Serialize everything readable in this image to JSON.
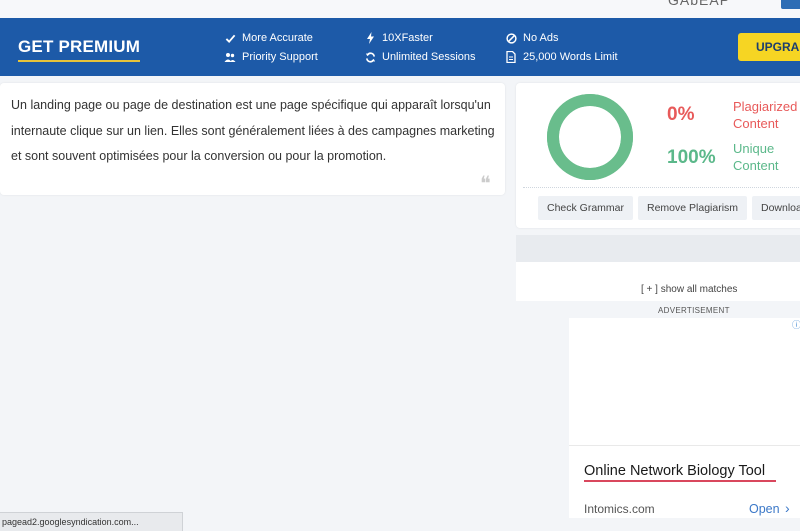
{
  "header_strip": {
    "cut_text": "GAbEAP"
  },
  "premium": {
    "title": "GET PREMIUM",
    "features": [
      {
        "icon": "check-icon",
        "label": "More Accurate"
      },
      {
        "icon": "users-icon",
        "label": "Priority Support"
      },
      {
        "icon": "bolt-icon",
        "label": "10XFaster"
      },
      {
        "icon": "refresh-icon",
        "label": "Unlimited Sessions"
      },
      {
        "icon": "no-ads-icon",
        "label": "No Ads"
      },
      {
        "icon": "document-icon",
        "label": "25,000 Words Limit"
      }
    ],
    "upgrade_label": "UPGRAD"
  },
  "input_text": "Un landing page ou page de destination est une page spécifique qui apparaît lorsqu'un internaute clique sur un lien. Elles sont généralement liées à des campagnes marketing et sont souvent optimisées pour la conversion ou pour la promotion.",
  "result": {
    "plagiarized_pct": "0%",
    "plagiarized_label": "Plagiarized Content",
    "unique_pct": "100%",
    "unique_label": "Unique Content",
    "unique_fraction": 1.0,
    "colors": {
      "unique": "#69bd8c",
      "plagiarized": "#e85a5a"
    },
    "actions": [
      "Check Grammar",
      "Remove Plagiarism",
      "Downloa"
    ]
  },
  "matches": {
    "show_all_label": "[ + ] show all matches"
  },
  "ad": {
    "label": "ADVERTISEMENT",
    "title": "Online Network Biology Tool",
    "domain": "Intomics.com",
    "open_label": "Open"
  },
  "status_bar": {
    "text": "pagead2.googlesyndication.com..."
  }
}
